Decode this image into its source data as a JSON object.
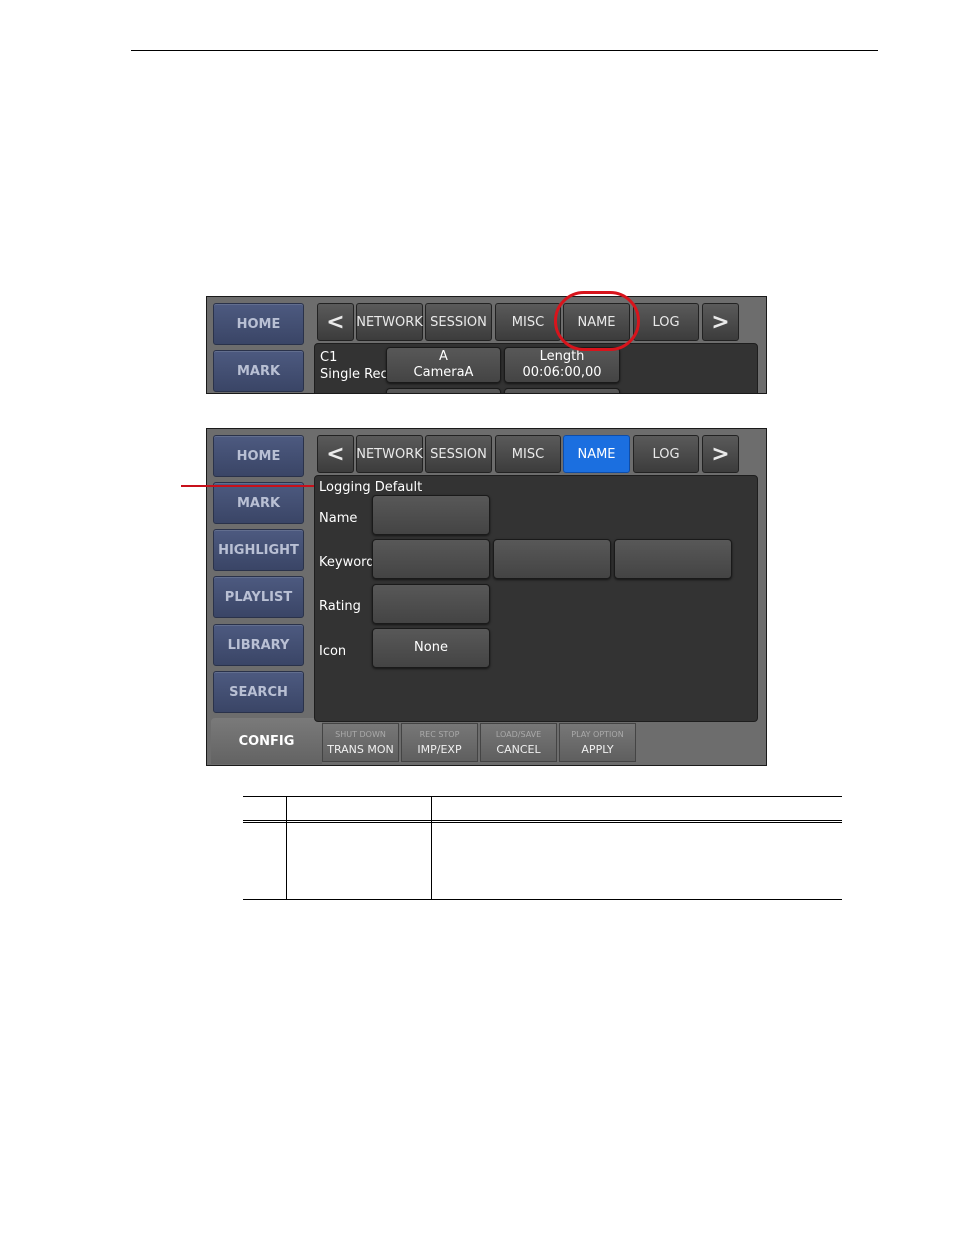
{
  "panel_top": {
    "sidebar": [
      "HOME",
      "MARK"
    ],
    "tabs": [
      {
        "label": "<",
        "icon": "chevron-left-icon"
      },
      {
        "label": "NETWORK"
      },
      {
        "label": "SESSION"
      },
      {
        "label": "MISC"
      },
      {
        "label": "NAME"
      },
      {
        "label": "LOG"
      },
      {
        "label": ">",
        "icon": "chevron-right-icon"
      }
    ],
    "channel": {
      "id": "C1",
      "mode": "Single Rec"
    },
    "camera_button": {
      "line1": "A",
      "line2": "CameraA"
    },
    "length_button": {
      "line1": "Length",
      "line2": "00:06:00,00"
    }
  },
  "panel_main": {
    "sidebar": [
      "HOME",
      "MARK",
      "HIGHLIGHT",
      "PLAYLIST",
      "LIBRARY",
      "SEARCH",
      "CONFIG"
    ],
    "tabs": [
      {
        "label": "<",
        "icon": "chevron-left-icon"
      },
      {
        "label": "NETWORK"
      },
      {
        "label": "SESSION"
      },
      {
        "label": "MISC"
      },
      {
        "label": "NAME",
        "active": true
      },
      {
        "label": "LOG"
      },
      {
        "label": ">",
        "icon": "chevron-right-icon"
      }
    ],
    "section_title": "Logging Default",
    "fields": {
      "name_label": "Name",
      "keyword_label": "Keyword",
      "rating_label": "Rating",
      "icon_label": "Icon",
      "icon_value": "None"
    },
    "bottom_buttons": [
      {
        "top": "SHUT DOWN",
        "main": "TRANS MON"
      },
      {
        "top": "REC STOP",
        "main": "IMP/EXP"
      },
      {
        "top": "LOAD/SAVE",
        "main": "CANCEL"
      },
      {
        "top": "PLAY OPTION",
        "main": "APPLY"
      }
    ],
    "active_tab_color": "#1b6fe0"
  },
  "annotation": {
    "circle_color": "#d8141c",
    "highlighted_tab": "NAME"
  }
}
